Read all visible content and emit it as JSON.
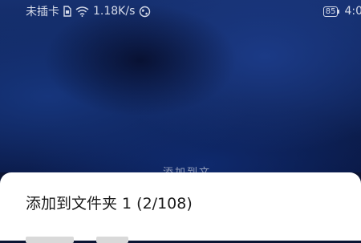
{
  "status_bar": {
    "carrier": "未插卡",
    "network_speed": "1.18K/s",
    "battery_level": "85",
    "time": "4:0",
    "icons": [
      "sim-card-icon",
      "wifi-icon",
      "vpn-globe-icon",
      "battery-icon"
    ]
  },
  "background": {
    "ghost_text": "添加到文"
  },
  "sheet": {
    "title": "添加到文件夹 1 (2/108)"
  },
  "colors": {
    "background_dark": "#0b1433",
    "background_blue": "#16306f",
    "status_text": "#d7dcea",
    "sheet_background": "#ffffff",
    "sheet_title": "#1c1c1c"
  }
}
